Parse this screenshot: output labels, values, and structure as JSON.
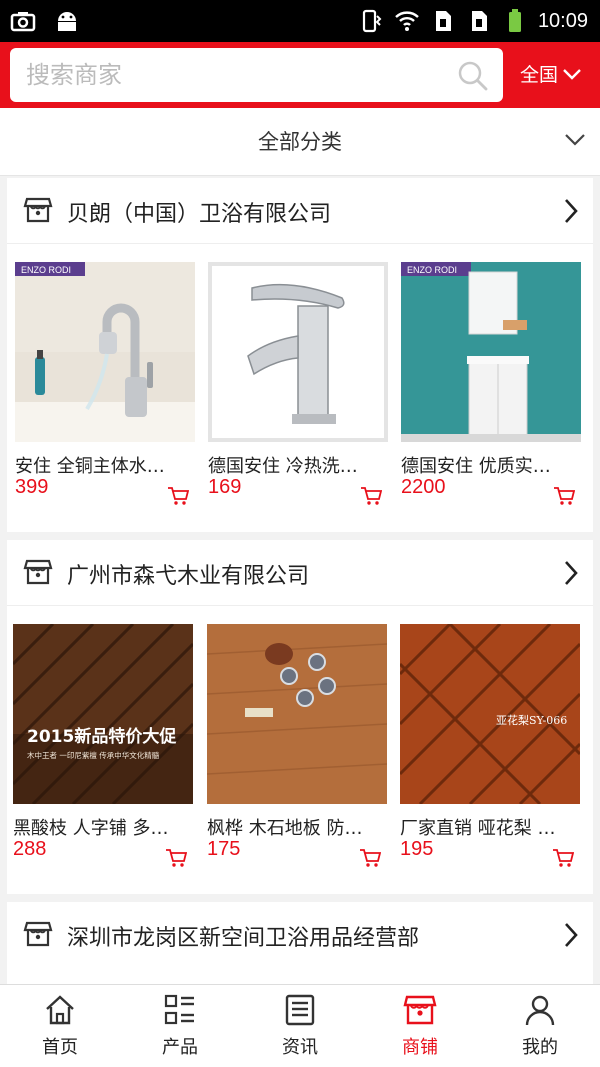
{
  "status_bar": {
    "time": "10:09",
    "icons": [
      "camera-icon",
      "android-icon",
      "vibrate-icon",
      "wifi-icon",
      "sim1-icon",
      "sim2-icon",
      "battery-icon"
    ]
  },
  "search": {
    "placeholder": "搜索商家",
    "region_label": "全国"
  },
  "category": {
    "label": "全部分类"
  },
  "colors": {
    "brand_red": "#e8101b",
    "price_red": "#e8101b"
  },
  "stores": [
    {
      "name": "贝朗（中国）卫浴有限公司",
      "products": [
        {
          "title": "安住 全铜主体水…",
          "price": "399",
          "image": "faucet-pull-out",
          "watermark": "ENZO RODI"
        },
        {
          "title": "德国安住 冷热洗…",
          "price": "169",
          "image": "faucet-chrome"
        },
        {
          "title": "德国安住 优质实…",
          "price": "2200",
          "image": "bathroom-cabinet",
          "watermark": "ENZO RODI"
        }
      ]
    },
    {
      "name": "广州市森弋木业有限公司",
      "products": [
        {
          "title": "黑酸枝 人字铺 多…",
          "price": "288",
          "image": "herringbone-floor-dark",
          "overlay_title": "2015新品特价大促",
          "overlay_sub": "木中王者 一印尼紫檀 传承中华文化精髓"
        },
        {
          "title": "枫桦 木石地板 防…",
          "price": "175",
          "image": "wood-floor-teaset"
        },
        {
          "title": "厂家直销 哑花梨 …",
          "price": "195",
          "image": "herringbone-floor-red",
          "overlay_sub": "亚花梨SY-066"
        }
      ]
    },
    {
      "name": "深圳市龙岗区新空间卫浴用品经营部",
      "products": []
    }
  ],
  "nav": [
    {
      "label": "首页",
      "icon": "home-icon",
      "active": false
    },
    {
      "label": "产品",
      "icon": "grid-list-icon",
      "active": false
    },
    {
      "label": "资讯",
      "icon": "news-icon",
      "active": false
    },
    {
      "label": "商铺",
      "icon": "shop-icon",
      "active": true
    },
    {
      "label": "我的",
      "icon": "user-icon",
      "active": false
    }
  ]
}
